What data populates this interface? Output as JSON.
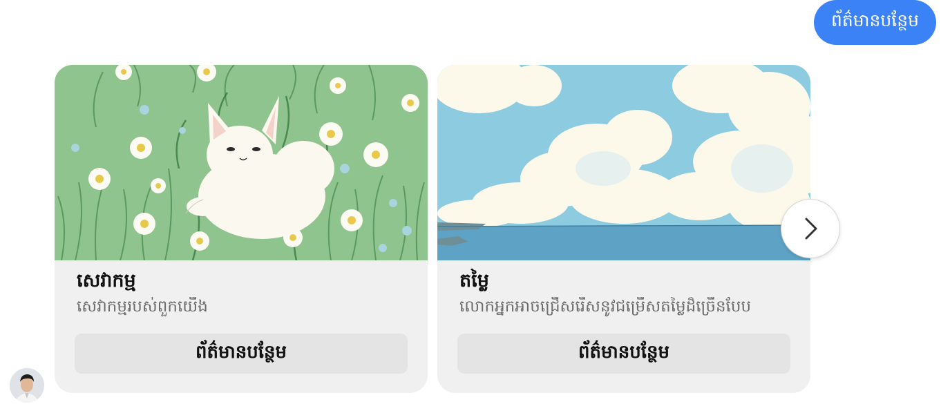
{
  "header": {
    "bubble_label": "ព័ត៌មានបន្ថែម"
  },
  "cards": [
    {
      "image_icon": "cat-in-meadow-illustration",
      "title": "សេវាកម្ម",
      "subtitle": "សេវាកម្មរបស់ពួកយើង",
      "button_label": "ព័ត៌មានបន្ថែម"
    },
    {
      "image_icon": "sky-sea-clouds-illustration",
      "title": "តម្លៃ",
      "subtitle": "លោកអ្នកអាចជ្រើសរើសនូវជម្រើសតម្លៃដ៏ច្រើនបែប",
      "button_label": "ព័ត៌មានបន្ថែម"
    }
  ],
  "navigation": {
    "next_icon": "chevron-right-icon"
  },
  "colors": {
    "accent": "#3b82f6",
    "card_bg": "#f0f0f0",
    "button_bg": "#e4e4e4"
  }
}
